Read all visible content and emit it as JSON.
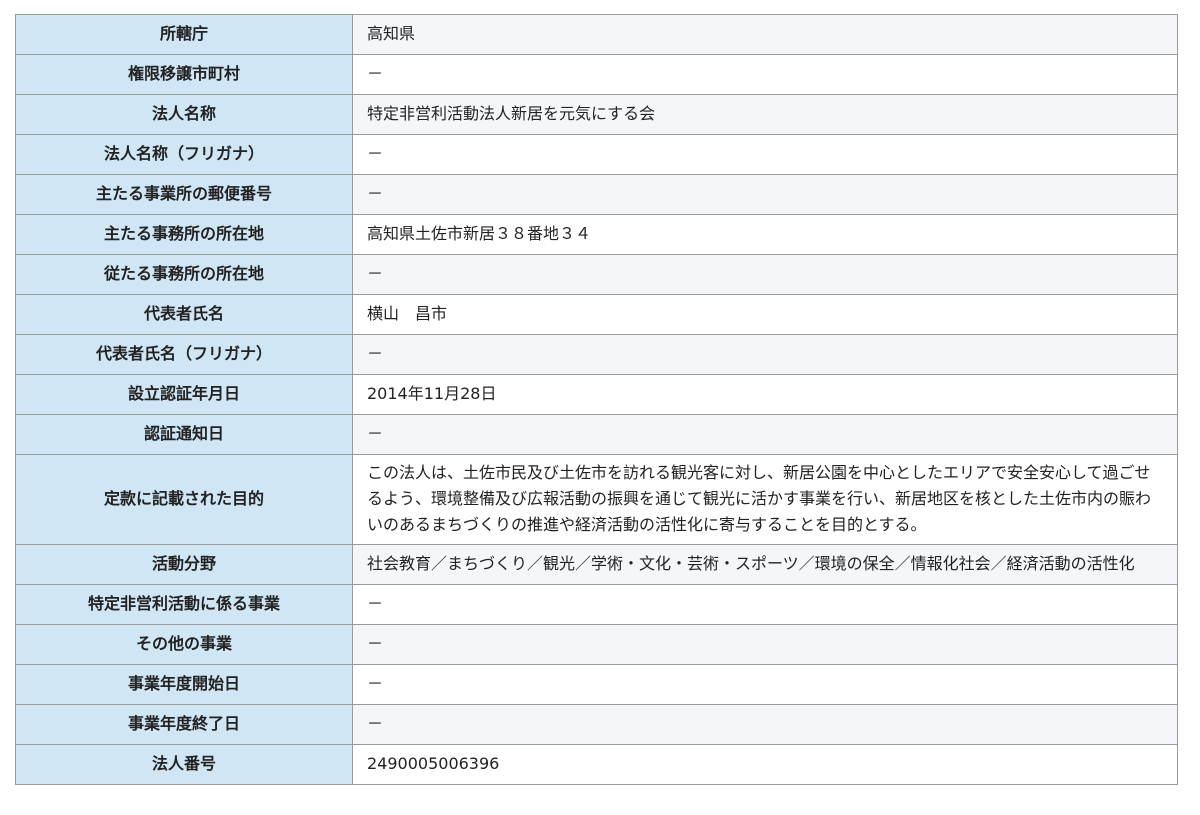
{
  "table": {
    "rows": [
      {
        "label": "所轄庁",
        "value": "高知県"
      },
      {
        "label": "権限移譲市町村",
        "value": "－"
      },
      {
        "label": "法人名称",
        "value": "特定非営利活動法人新居を元気にする会"
      },
      {
        "label": "法人名称（フリガナ）",
        "value": "－"
      },
      {
        "label": "主たる事業所の郵便番号",
        "value": "－"
      },
      {
        "label": "主たる事務所の所在地",
        "value": "高知県土佐市新居３８番地３４"
      },
      {
        "label": "従たる事務所の所在地",
        "value": "－"
      },
      {
        "label": "代表者氏名",
        "value": "横山　昌市"
      },
      {
        "label": "代表者氏名（フリガナ）",
        "value": "－"
      },
      {
        "label": "設立認証年月日",
        "value": "2014年11月28日"
      },
      {
        "label": "認証通知日",
        "value": "－"
      },
      {
        "label": "定款に記載された目的",
        "value": "この法人は、土佐市民及び土佐市を訪れる観光客に対し、新居公園を中心としたエリアで安全安心して過ごせるよう、環境整備及び広報活動の振興を通じて観光に活かす事業を行い、新居地区を核とした土佐市内の賑わいのあるまちづくりの推進や経済活動の活性化に寄与することを目的とする。"
      },
      {
        "label": "活動分野",
        "value": "社会教育／まちづくり／観光／学術・文化・芸術・スポーツ／環境の保全／情報化社会／経済活動の活性化"
      },
      {
        "label": "特定非営利活動に係る事業",
        "value": "－"
      },
      {
        "label": "その他の事業",
        "value": "－"
      },
      {
        "label": "事業年度開始日",
        "value": "－"
      },
      {
        "label": "事業年度終了日",
        "value": "－"
      },
      {
        "label": "法人番号",
        "value": "2490005006396"
      }
    ]
  }
}
